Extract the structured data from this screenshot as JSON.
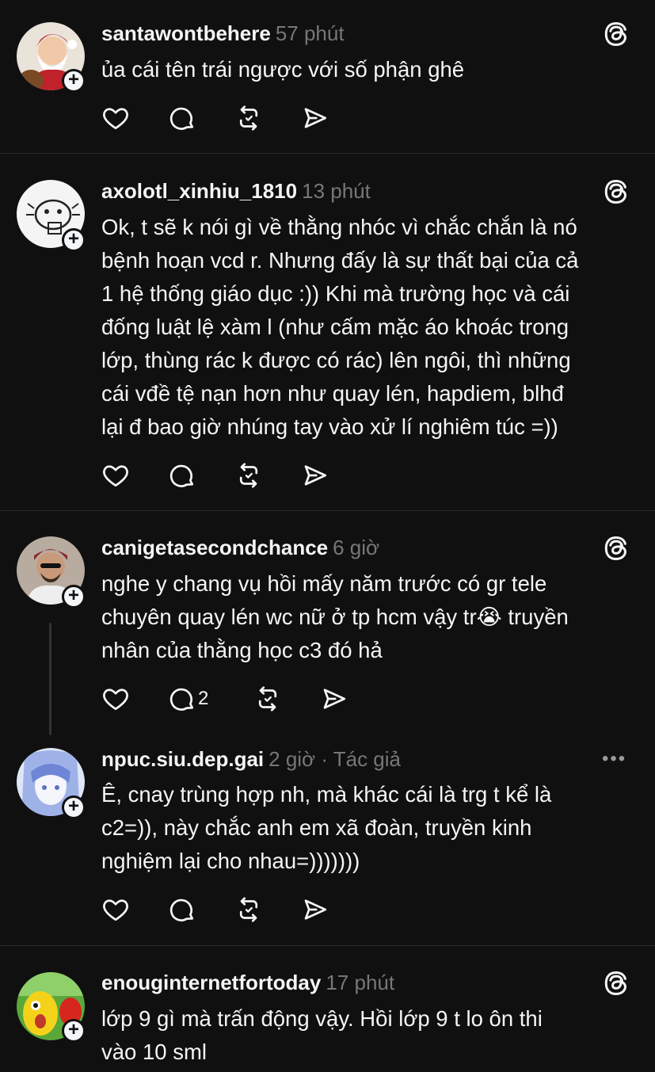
{
  "posts": [
    {
      "username": "santawontbehere",
      "time": "57 phút",
      "text": "ủa cái tên trái ngược với số phận ghê",
      "replies": ""
    },
    {
      "username": "axolotl_xinhiu_1810",
      "time": "13 phút",
      "text": "Ok, t sẽ k nói gì về thằng nhóc vì chắc chắn là nó\nbệnh hoạn vcd r. Nhưng đấy là sự thất bại của cả\n1 hệ thống giáo dục :)) Khi mà trường học và cái\nđống luật lệ xàm l (như cấm mặc áo khoác trong\nlớp, thùng rác k được có rác) lên ngôi, thì những\ncái vđề tệ nạn hơn như quay lén, hapdiem, blhđ\nlại đ bao giờ nhúng tay vào xử lí nghiêm túc =))",
      "replies": ""
    },
    {
      "username": "canigetasecondchance",
      "time": "6 giờ",
      "text": "nghe y chang vụ hồi mấy năm trước có gr tele\nchuyên quay lén wc nữ ở tp hcm vậy tr😭 truyền\nnhân của thằng học c3 đó hả",
      "replies": "2"
    },
    {
      "username": "npuc.siu.dep.gai",
      "time": "2 giờ · Tác giả",
      "text": "Ê, cnay trùng hợp nh, mà khác cái là trg t kể là\nc2=)), này chắc anh em xã đoàn, truyền kinh\nnghiệm lại cho nhau=)))))))",
      "replies": ""
    },
    {
      "username": "enouginternetfortoday",
      "time": "17 phút",
      "text": "lớp 9 gì mà trấn động vậy. Hồi lớp 9 t lo ôn thi\nvào 10 sml",
      "replies": ""
    }
  ],
  "icons": {
    "like": "heart-icon",
    "reply": "comment-icon",
    "repost": "repost-icon",
    "share": "send-icon",
    "threads": "threads-icon",
    "more": "more-icon",
    "follow": "plus-icon"
  },
  "more_label": "•••",
  "plus_label": "+"
}
